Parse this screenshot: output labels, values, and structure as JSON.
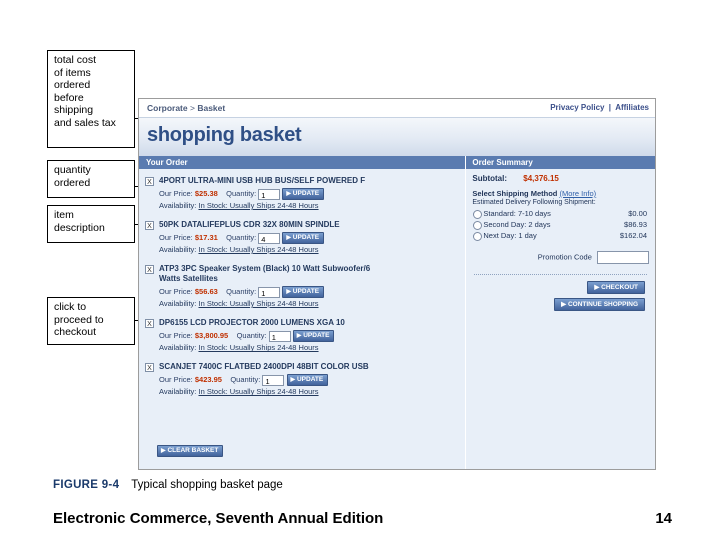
{
  "callouts": [
    {
      "id": "total-cost",
      "text": "total cost\nof items\nordered\nbefore\nshipping\nand sales tax"
    },
    {
      "id": "quantity-ordered",
      "text": "quantity\nordered"
    },
    {
      "id": "item-description",
      "text": "item\ndescription"
    },
    {
      "id": "checkout",
      "text": "click to\nproceed to\ncheckout"
    }
  ],
  "screen": {
    "breadcrumb": {
      "home": "Corporate",
      "sep": ">",
      "current": "Basket"
    },
    "top_links": {
      "privacy": "Privacy Policy",
      "divider": "|",
      "affiliates": "Affiliates"
    },
    "banner_title": "shopping basket",
    "order_header": "Your Order",
    "summary_header": "Order Summary",
    "labels": {
      "our_price": "Our Price:",
      "quantity": "Quantity:",
      "availability": "Availability:",
      "update": "UPDATE",
      "clear_basket": "CLEAR BASKET",
      "checkout": "CHECKOUT",
      "continue_shopping": "CONTINUE SHOPPING",
      "delete_box": "X",
      "caret": "▶"
    },
    "items": [
      {
        "name": "4PORT ULTRA-MINI USB HUB BUS/SELF POWERED F",
        "price": "$25.38",
        "qty": "1",
        "availability": "In Stock: Usually Ships 24-48 Hours"
      },
      {
        "name": "50PK DATALIFEPLUS CDR 32X 80MIN SPINDLE",
        "price": "$17.31",
        "qty": "4",
        "availability": "In Stock: Usually Ships 24-48 Hours"
      },
      {
        "name": "ATP3 3PC Speaker System (Black) 10 Watt Subwoofer/6 Watts Satellites",
        "price": "$56.63",
        "qty": "1",
        "availability": "In Stock: Usually Ships 24-48 Hours"
      },
      {
        "name": "DP6155 LCD PROJECTOR 2000 LUMENS XGA 10",
        "price": "$3,800.95",
        "qty": "1",
        "availability": "In Stock: Usually Ships 24-48 Hours"
      },
      {
        "name": "SCANJET 7400C FLATBED 2400DPI 48BIT COLOR USB",
        "price": "$423.95",
        "qty": "1",
        "availability": "In Stock: Usually Ships 24-48 Hours"
      }
    ],
    "summary": {
      "subtotal_label": "Subtotal:",
      "subtotal_value": "$4,376.15",
      "shipping_method_label": "Select Shipping Method",
      "more_info": "(More Info)",
      "delivery_note": "Estimated Delivery Following Shipment:",
      "shipping_options": [
        {
          "label": "Standard: 7-10 days",
          "cost": "$0.00"
        },
        {
          "label": "Second Day: 2 days",
          "cost": "$86.93"
        },
        {
          "label": "Next Day: 1 day",
          "cost": "$162.04"
        }
      ],
      "promotion_label": "Promotion Code",
      "promotion_value": ""
    }
  },
  "figure": {
    "label": "FIGURE 9-4",
    "caption": "Typical shopping basket page"
  },
  "footer": {
    "title": "Electronic Commerce, Seventh Annual Edition",
    "page": "14"
  }
}
